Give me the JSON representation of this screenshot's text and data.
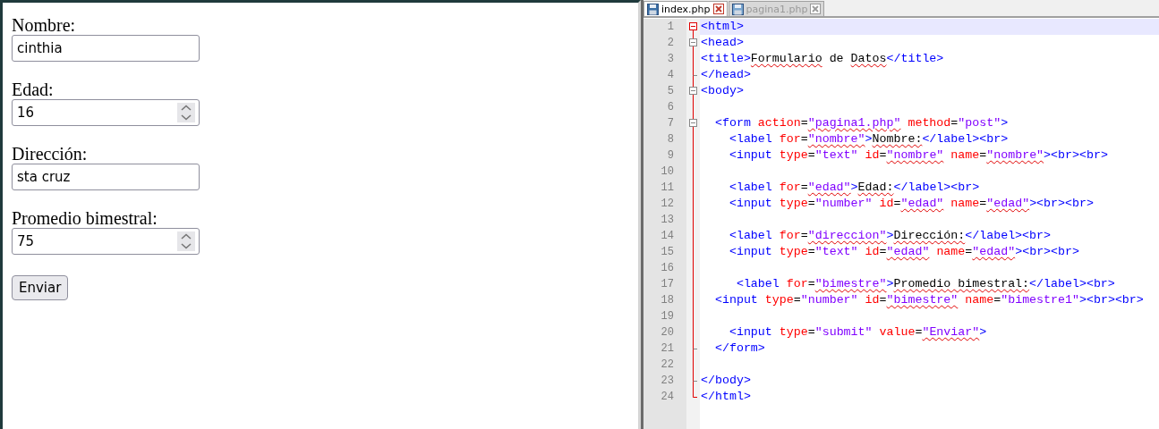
{
  "form": {
    "fields": [
      {
        "label": "Nombre:",
        "value": "cinthia",
        "kind": "text"
      },
      {
        "label": "Edad:",
        "value": "16",
        "kind": "number"
      },
      {
        "label": "Dirección:",
        "value": "sta cruz",
        "kind": "text"
      },
      {
        "label": "Promedio bimestral:",
        "value": "75",
        "kind": "number"
      }
    ],
    "submit": "Enviar"
  },
  "editor": {
    "tabs": [
      {
        "label": "index.php",
        "selected": true
      },
      {
        "label": "pagina1.php",
        "selected": false
      }
    ],
    "lines": [
      {
        "number": "1",
        "kind": "open",
        "current": true,
        "tokens": [
          {
            "kind": "tag",
            "text": "<html>"
          }
        ]
      },
      {
        "number": "2",
        "kind": "open",
        "current": false,
        "tokens": [
          {
            "kind": "tag",
            "text": "<head>"
          }
        ]
      },
      {
        "number": "3",
        "kind": "line",
        "current": false,
        "tokens": [
          {
            "kind": "tag",
            "text": "<title>"
          },
          {
            "kind": "misspelled_text",
            "text": "Formulario"
          },
          {
            "kind": "text",
            "text": " de "
          },
          {
            "kind": "misspelled_text",
            "text": "Datos"
          },
          {
            "kind": "tag",
            "text": "</title>"
          }
        ]
      },
      {
        "number": "4",
        "kind": "close",
        "current": false,
        "tokens": [
          {
            "kind": "tag",
            "text": "</head>"
          }
        ]
      },
      {
        "number": "5",
        "kind": "open",
        "current": false,
        "tokens": [
          {
            "kind": "tag",
            "text": "<body>"
          }
        ]
      },
      {
        "number": "6",
        "kind": "line",
        "current": false
      },
      {
        "number": "7",
        "kind": "open",
        "current": false,
        "tokens": [
          {
            "kind": "tag",
            "text": "  <form"
          },
          {
            "kind": "attr",
            "text": " action"
          },
          {
            "kind": "text",
            "text": "="
          },
          {
            "kind": "misspelled_value",
            "text": "\"pagina1.php\""
          },
          {
            "kind": "attr",
            "text": " method"
          },
          {
            "kind": "text",
            "text": "="
          },
          {
            "kind": "value",
            "text": "\"post\""
          },
          {
            "kind": "tag",
            "text": ">"
          }
        ]
      },
      {
        "number": "8",
        "kind": "line",
        "current": false,
        "tokens": [
          {
            "kind": "tag",
            "text": "    <label"
          },
          {
            "kind": "attr",
            "text": " for"
          },
          {
            "kind": "text",
            "text": "="
          },
          {
            "kind": "misspelled_value",
            "text": "\"nombre\""
          },
          {
            "kind": "tag",
            "text": ">"
          },
          {
            "kind": "misspelled_text",
            "text": "Nombre:"
          },
          {
            "kind": "tag",
            "text": "</label><br>"
          }
        ]
      },
      {
        "number": "9",
        "kind": "line",
        "current": false,
        "tokens": [
          {
            "kind": "tag",
            "text": "    <input"
          },
          {
            "kind": "attr",
            "text": " type"
          },
          {
            "kind": "text",
            "text": "="
          },
          {
            "kind": "value",
            "text": "\"text\""
          },
          {
            "kind": "attr",
            "text": " id"
          },
          {
            "kind": "text",
            "text": "="
          },
          {
            "kind": "misspelled_value",
            "text": "\"nombre\""
          },
          {
            "kind": "attr",
            "text": " name"
          },
          {
            "kind": "text",
            "text": "="
          },
          {
            "kind": "misspelled_value",
            "text": "\"nombre\""
          },
          {
            "kind": "tag",
            "text": "><br><br>"
          }
        ]
      },
      {
        "number": "10",
        "kind": "line",
        "current": false
      },
      {
        "number": "11",
        "kind": "line",
        "current": false,
        "tokens": [
          {
            "kind": "tag",
            "text": "    <label"
          },
          {
            "kind": "attr",
            "text": " for"
          },
          {
            "kind": "text",
            "text": "="
          },
          {
            "kind": "misspelled_value",
            "text": "\"edad\""
          },
          {
            "kind": "tag",
            "text": ">"
          },
          {
            "kind": "misspelled_text",
            "text": "Edad:"
          },
          {
            "kind": "tag",
            "text": "</label><br>"
          }
        ]
      },
      {
        "number": "12",
        "kind": "line",
        "current": false,
        "tokens": [
          {
            "kind": "tag",
            "text": "    <input"
          },
          {
            "kind": "attr",
            "text": " type"
          },
          {
            "kind": "text",
            "text": "="
          },
          {
            "kind": "value",
            "text": "\"number\""
          },
          {
            "kind": "attr",
            "text": " id"
          },
          {
            "kind": "text",
            "text": "="
          },
          {
            "kind": "misspelled_value",
            "text": "\"edad\""
          },
          {
            "kind": "attr",
            "text": " name"
          },
          {
            "kind": "text",
            "text": "="
          },
          {
            "kind": "misspelled_value",
            "text": "\"edad\""
          },
          {
            "kind": "tag",
            "text": "><br><br>"
          }
        ]
      },
      {
        "number": "13",
        "kind": "line",
        "current": false
      },
      {
        "number": "14",
        "kind": "line",
        "current": false,
        "tokens": [
          {
            "kind": "tag",
            "text": "    <label"
          },
          {
            "kind": "attr",
            "text": " for"
          },
          {
            "kind": "text",
            "text": "="
          },
          {
            "kind": "misspelled_value",
            "text": "\"direccion\""
          },
          {
            "kind": "tag",
            "text": ">"
          },
          {
            "kind": "misspelled_text",
            "text": "Dirección:"
          },
          {
            "kind": "tag",
            "text": "</label><br>"
          }
        ]
      },
      {
        "number": "15",
        "kind": "line",
        "current": false,
        "tokens": [
          {
            "kind": "tag",
            "text": "    <input"
          },
          {
            "kind": "attr",
            "text": " type"
          },
          {
            "kind": "text",
            "text": "="
          },
          {
            "kind": "value",
            "text": "\"text\""
          },
          {
            "kind": "attr",
            "text": " id"
          },
          {
            "kind": "text",
            "text": "="
          },
          {
            "kind": "misspelled_value",
            "text": "\"edad\""
          },
          {
            "kind": "attr",
            "text": " name"
          },
          {
            "kind": "text",
            "text": "="
          },
          {
            "kind": "misspelled_value",
            "text": "\"edad\""
          },
          {
            "kind": "tag",
            "text": "><br><br>"
          }
        ]
      },
      {
        "number": "16",
        "kind": "line",
        "current": false
      },
      {
        "number": "17",
        "kind": "line",
        "current": false,
        "tokens": [
          {
            "kind": "tag",
            "text": "     <label"
          },
          {
            "kind": "attr",
            "text": " for"
          },
          {
            "kind": "text",
            "text": "="
          },
          {
            "kind": "misspelled_value",
            "text": "\"bimestre\""
          },
          {
            "kind": "tag",
            "text": ">"
          },
          {
            "kind": "misspelled_text",
            "text": "Promedio bimestral:"
          },
          {
            "kind": "tag",
            "text": "</label><br>"
          }
        ]
      },
      {
        "number": "18",
        "kind": "line",
        "current": false,
        "tokens": [
          {
            "kind": "tag",
            "text": "  <input"
          },
          {
            "kind": "attr",
            "text": " type"
          },
          {
            "kind": "text",
            "text": "="
          },
          {
            "kind": "value",
            "text": "\"number\""
          },
          {
            "kind": "attr",
            "text": " id"
          },
          {
            "kind": "text",
            "text": "="
          },
          {
            "kind": "misspelled_value",
            "text": "\"bimestre\""
          },
          {
            "kind": "attr",
            "text": " name"
          },
          {
            "kind": "text",
            "text": "="
          },
          {
            "kind": "value",
            "text": "\"bimestre1\""
          },
          {
            "kind": "tag",
            "text": "><br><br>"
          }
        ]
      },
      {
        "number": "19",
        "kind": "line",
        "current": false
      },
      {
        "number": "20",
        "kind": "line",
        "current": false,
        "tokens": [
          {
            "kind": "tag",
            "text": "    <input"
          },
          {
            "kind": "attr",
            "text": " type"
          },
          {
            "kind": "text",
            "text": "="
          },
          {
            "kind": "value",
            "text": "\"submit\""
          },
          {
            "kind": "attr",
            "text": " value"
          },
          {
            "kind": "text",
            "text": "="
          },
          {
            "kind": "misspelled_value",
            "text": "\"Enviar\""
          },
          {
            "kind": "tag",
            "text": ">"
          }
        ]
      },
      {
        "number": "21",
        "kind": "close",
        "current": false,
        "tokens": [
          {
            "kind": "tag",
            "text": "  </form>"
          }
        ]
      },
      {
        "number": "22",
        "kind": "line",
        "current": false
      },
      {
        "number": "23",
        "kind": "close",
        "current": false,
        "tokens": [
          {
            "kind": "tag",
            "text": "</body>"
          }
        ]
      },
      {
        "number": "24",
        "kind": "end",
        "current": false,
        "tokens": [
          {
            "kind": "tag",
            "text": "</html>"
          }
        ]
      }
    ]
  }
}
